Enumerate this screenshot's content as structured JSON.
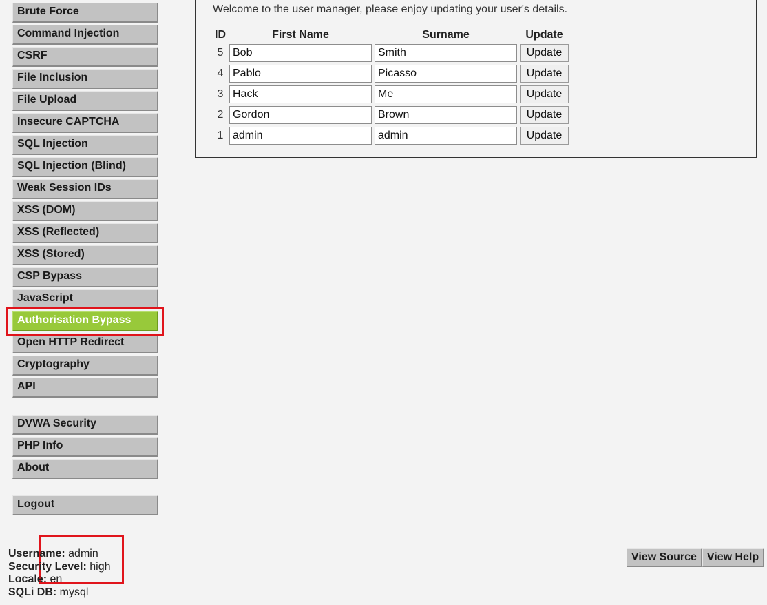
{
  "menu": {
    "main": [
      {
        "label": "Brute Force",
        "selected": false
      },
      {
        "label": "Command Injection",
        "selected": false
      },
      {
        "label": "CSRF",
        "selected": false
      },
      {
        "label": "File Inclusion",
        "selected": false
      },
      {
        "label": "File Upload",
        "selected": false
      },
      {
        "label": "Insecure CAPTCHA",
        "selected": false
      },
      {
        "label": "SQL Injection",
        "selected": false
      },
      {
        "label": "SQL Injection (Blind)",
        "selected": false
      },
      {
        "label": "Weak Session IDs",
        "selected": false
      },
      {
        "label": "XSS (DOM)",
        "selected": false
      },
      {
        "label": "XSS (Reflected)",
        "selected": false
      },
      {
        "label": "XSS (Stored)",
        "selected": false
      },
      {
        "label": "CSP Bypass",
        "selected": false
      },
      {
        "label": "JavaScript",
        "selected": false
      },
      {
        "label": "Authorisation Bypass",
        "selected": true
      },
      {
        "label": "Open HTTP Redirect",
        "selected": false
      },
      {
        "label": "Cryptography",
        "selected": false
      },
      {
        "label": "API",
        "selected": false
      }
    ],
    "secondary": [
      {
        "label": "DVWA Security"
      },
      {
        "label": "PHP Info"
      },
      {
        "label": "About"
      }
    ],
    "logout": {
      "label": "Logout"
    },
    "selected_color": "#98c93a",
    "item_color": "#c2c2c2"
  },
  "content": {
    "welcome": "Welcome to the user manager, please enjoy updating your user's details.",
    "headers": {
      "id": "ID",
      "first_name": "First Name",
      "surname": "Surname",
      "update": "Update"
    },
    "users": [
      {
        "id": "5",
        "first_name": "Bob",
        "surname": "Smith",
        "button": "Update"
      },
      {
        "id": "4",
        "first_name": "Pablo",
        "surname": "Picasso",
        "button": "Update"
      },
      {
        "id": "3",
        "first_name": "Hack",
        "surname": "Me",
        "button": "Update"
      },
      {
        "id": "2",
        "first_name": "Gordon",
        "surname": "Brown",
        "button": "Update"
      },
      {
        "id": "1",
        "first_name": "admin",
        "surname": "admin",
        "button": "Update"
      }
    ]
  },
  "footer": {
    "username_label": "Username:",
    "username": "admin",
    "security_label": "Security Level:",
    "security": "high",
    "locale_label": "Locale:",
    "locale": "en",
    "sqli_label": "SQLi DB:",
    "sqli": "mysql",
    "view_source": "View Source",
    "view_help": "View Help"
  },
  "annotation_color": "#e0141b"
}
